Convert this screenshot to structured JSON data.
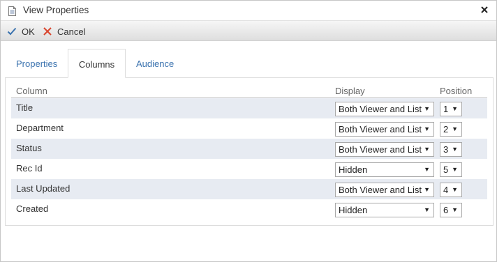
{
  "window": {
    "title": "View Properties",
    "close_icon": "close-icon",
    "title_icon": "document-icon"
  },
  "toolbar": {
    "ok_label": "OK",
    "cancel_label": "Cancel",
    "ok_icon": "checkmark-icon",
    "cancel_icon": "x-icon",
    "ok_color": "#3b73af",
    "cancel_color": "#d9452e"
  },
  "tabs": [
    {
      "label": "Properties",
      "active": false
    },
    {
      "label": "Columns",
      "active": true
    },
    {
      "label": "Audience",
      "active": false
    }
  ],
  "grid": {
    "headers": {
      "column": "Column",
      "display": "Display",
      "position": "Position"
    },
    "rows": [
      {
        "column": "Title",
        "display": "Both Viewer and List",
        "position": "1"
      },
      {
        "column": "Department",
        "display": "Both Viewer and List",
        "position": "2"
      },
      {
        "column": "Status",
        "display": "Both Viewer and List",
        "position": "3"
      },
      {
        "column": "Rec Id",
        "display": "Hidden",
        "position": "5"
      },
      {
        "column": "Last Updated",
        "display": "Both Viewer and List",
        "position": "4"
      },
      {
        "column": "Created",
        "display": "Hidden",
        "position": "6"
      }
    ]
  },
  "colors": {
    "link": "#3b73af",
    "row_alt": "#e7ebf2"
  }
}
